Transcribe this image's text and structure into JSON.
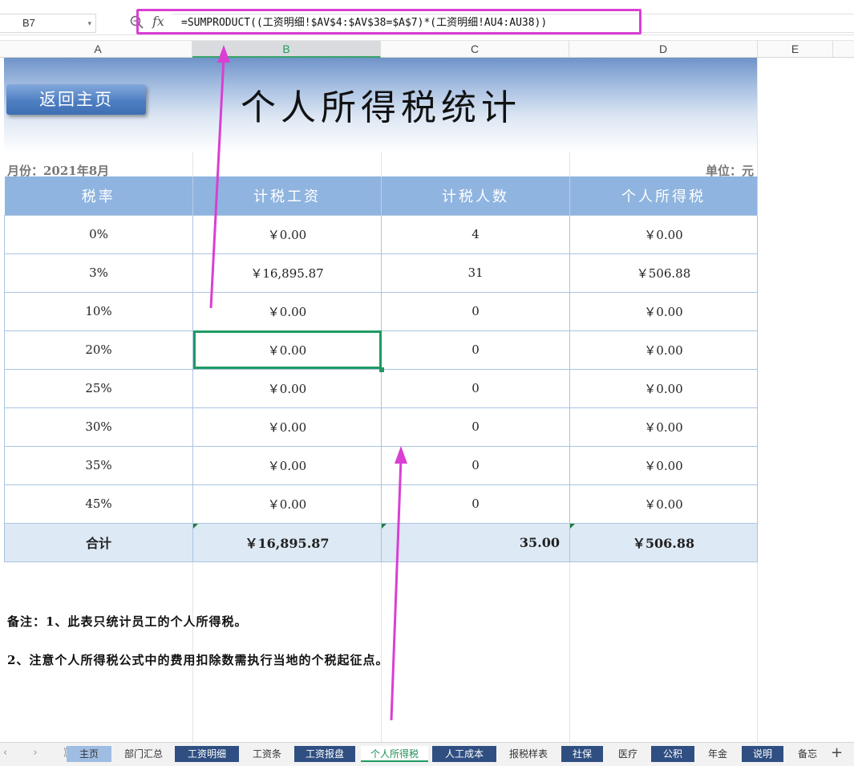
{
  "formula_bar": {
    "cell_ref": "B7",
    "dropdown_glyph": "▾",
    "fx_label": "fx",
    "formula": "=SUMPRODUCT((工资明细!$AV$4:$AV$38=$A$7)*(工资明细!AU4:AU38))"
  },
  "columns": [
    "A",
    "B",
    "C",
    "D",
    "E"
  ],
  "sheet": {
    "home_button": "返回主页",
    "title": "个人所得税统计",
    "month_label": "月份：2021年8月",
    "unit_label": "单位：元",
    "headers": [
      "税率",
      "计税工资",
      "计税人数",
      "个人所得税"
    ],
    "rows": [
      [
        "0%",
        "￥0.00",
        "4",
        "￥0.00"
      ],
      [
        "3%",
        "￥16,895.87",
        "31",
        "￥506.88"
      ],
      [
        "10%",
        "￥0.00",
        "0",
        "￥0.00"
      ],
      [
        "20%",
        "￥0.00",
        "0",
        "￥0.00"
      ],
      [
        "25%",
        "￥0.00",
        "0",
        "￥0.00"
      ],
      [
        "30%",
        "￥0.00",
        "0",
        "￥0.00"
      ],
      [
        "35%",
        "￥0.00",
        "0",
        "￥0.00"
      ],
      [
        "45%",
        "￥0.00",
        "0",
        "￥0.00"
      ]
    ],
    "total": [
      "合计",
      "￥16,895.87",
      "35.00",
      "￥506.88"
    ],
    "notes": [
      "备注：1、此表只统计员工的个人所得税。",
      "2、注意个人所得税公式中的费用扣除数需执行当地的个税起征点。"
    ]
  },
  "tabs": {
    "nav_arrows": "‹ › ⟫",
    "items": [
      "主页",
      "部门汇总",
      "工资明细",
      "工资条",
      "工资报盘",
      "个人所得税",
      "人工成本",
      "报税样表",
      "社保",
      "医疗",
      "公积",
      "年金",
      "说明",
      "备忘"
    ],
    "active": "个人所得税",
    "add_glyph": "+"
  },
  "colors": {
    "annotation": "#d93fd3",
    "header_blue": "#8fb4df",
    "selection_green": "#1e9a63",
    "tab_dark": "#2f4f82"
  }
}
